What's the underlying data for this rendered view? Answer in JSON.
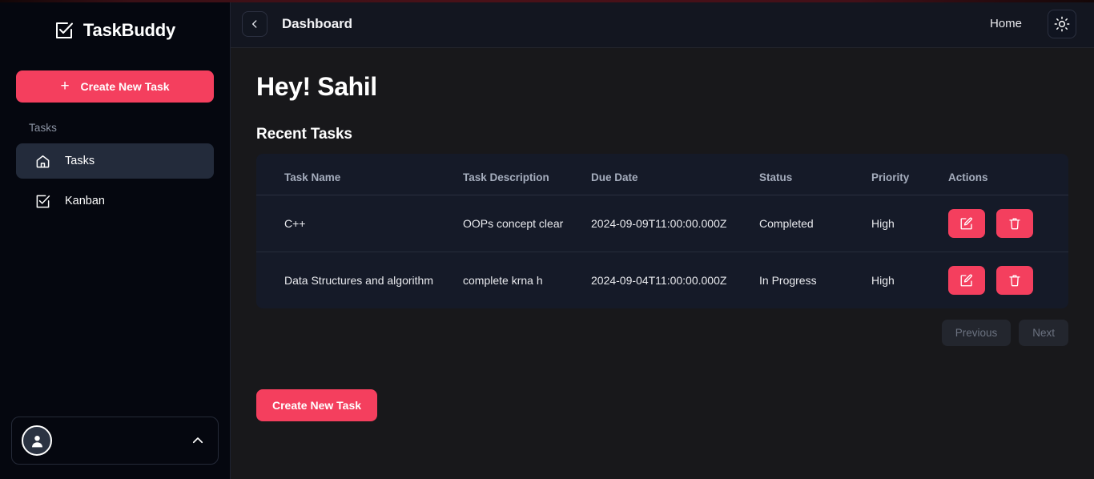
{
  "theme": {
    "accent": "#f43f5e",
    "sidebar_bg": "#05070f",
    "main_bg": "#18181b",
    "table_bg": "#151a28",
    "active_nav_bg": "#232b3b",
    "topbar_bg": "#131620"
  },
  "sidebar": {
    "brand": {
      "name": "TaskBuddy",
      "icon": "checkbox-check-icon"
    },
    "create_button": {
      "label": "Create New Task",
      "plus": "+"
    },
    "section_label": "Tasks",
    "items": [
      {
        "label": "Tasks",
        "icon": "home-icon",
        "active": true
      },
      {
        "label": "Kanban",
        "icon": "checkbox-check-icon",
        "active": false
      }
    ],
    "profile": {
      "avatar_icon": "user-avatar-icon",
      "chevron_icon": "chevron-up-icon"
    }
  },
  "topbar": {
    "collapse_icon": "chevron-left-icon",
    "title": "Dashboard",
    "home_label": "Home",
    "theme_icon": "sun-icon"
  },
  "main": {
    "greeting": "Hey! Sahil",
    "section_title": "Recent Tasks",
    "table": {
      "columns": [
        "Task Name",
        "Task Description",
        "Due Date",
        "Status",
        "Priority",
        "Actions"
      ],
      "rows": [
        {
          "name": "C++",
          "description": "OOPs concept clear",
          "due_date": "2024-09-09T11:00:00.000Z",
          "status": "Completed",
          "priority": "High",
          "actions": [
            "edit-icon",
            "delete-icon"
          ]
        },
        {
          "name": "Data Structures and algorithm",
          "description": "complete krna h",
          "due_date": "2024-09-04T11:00:00.000Z",
          "status": "In Progress",
          "priority": "High",
          "actions": [
            "edit-icon",
            "delete-icon"
          ]
        }
      ]
    },
    "pagination": {
      "previous_label": "Previous",
      "next_label": "Next"
    },
    "create_button_label": "Create New Task"
  }
}
